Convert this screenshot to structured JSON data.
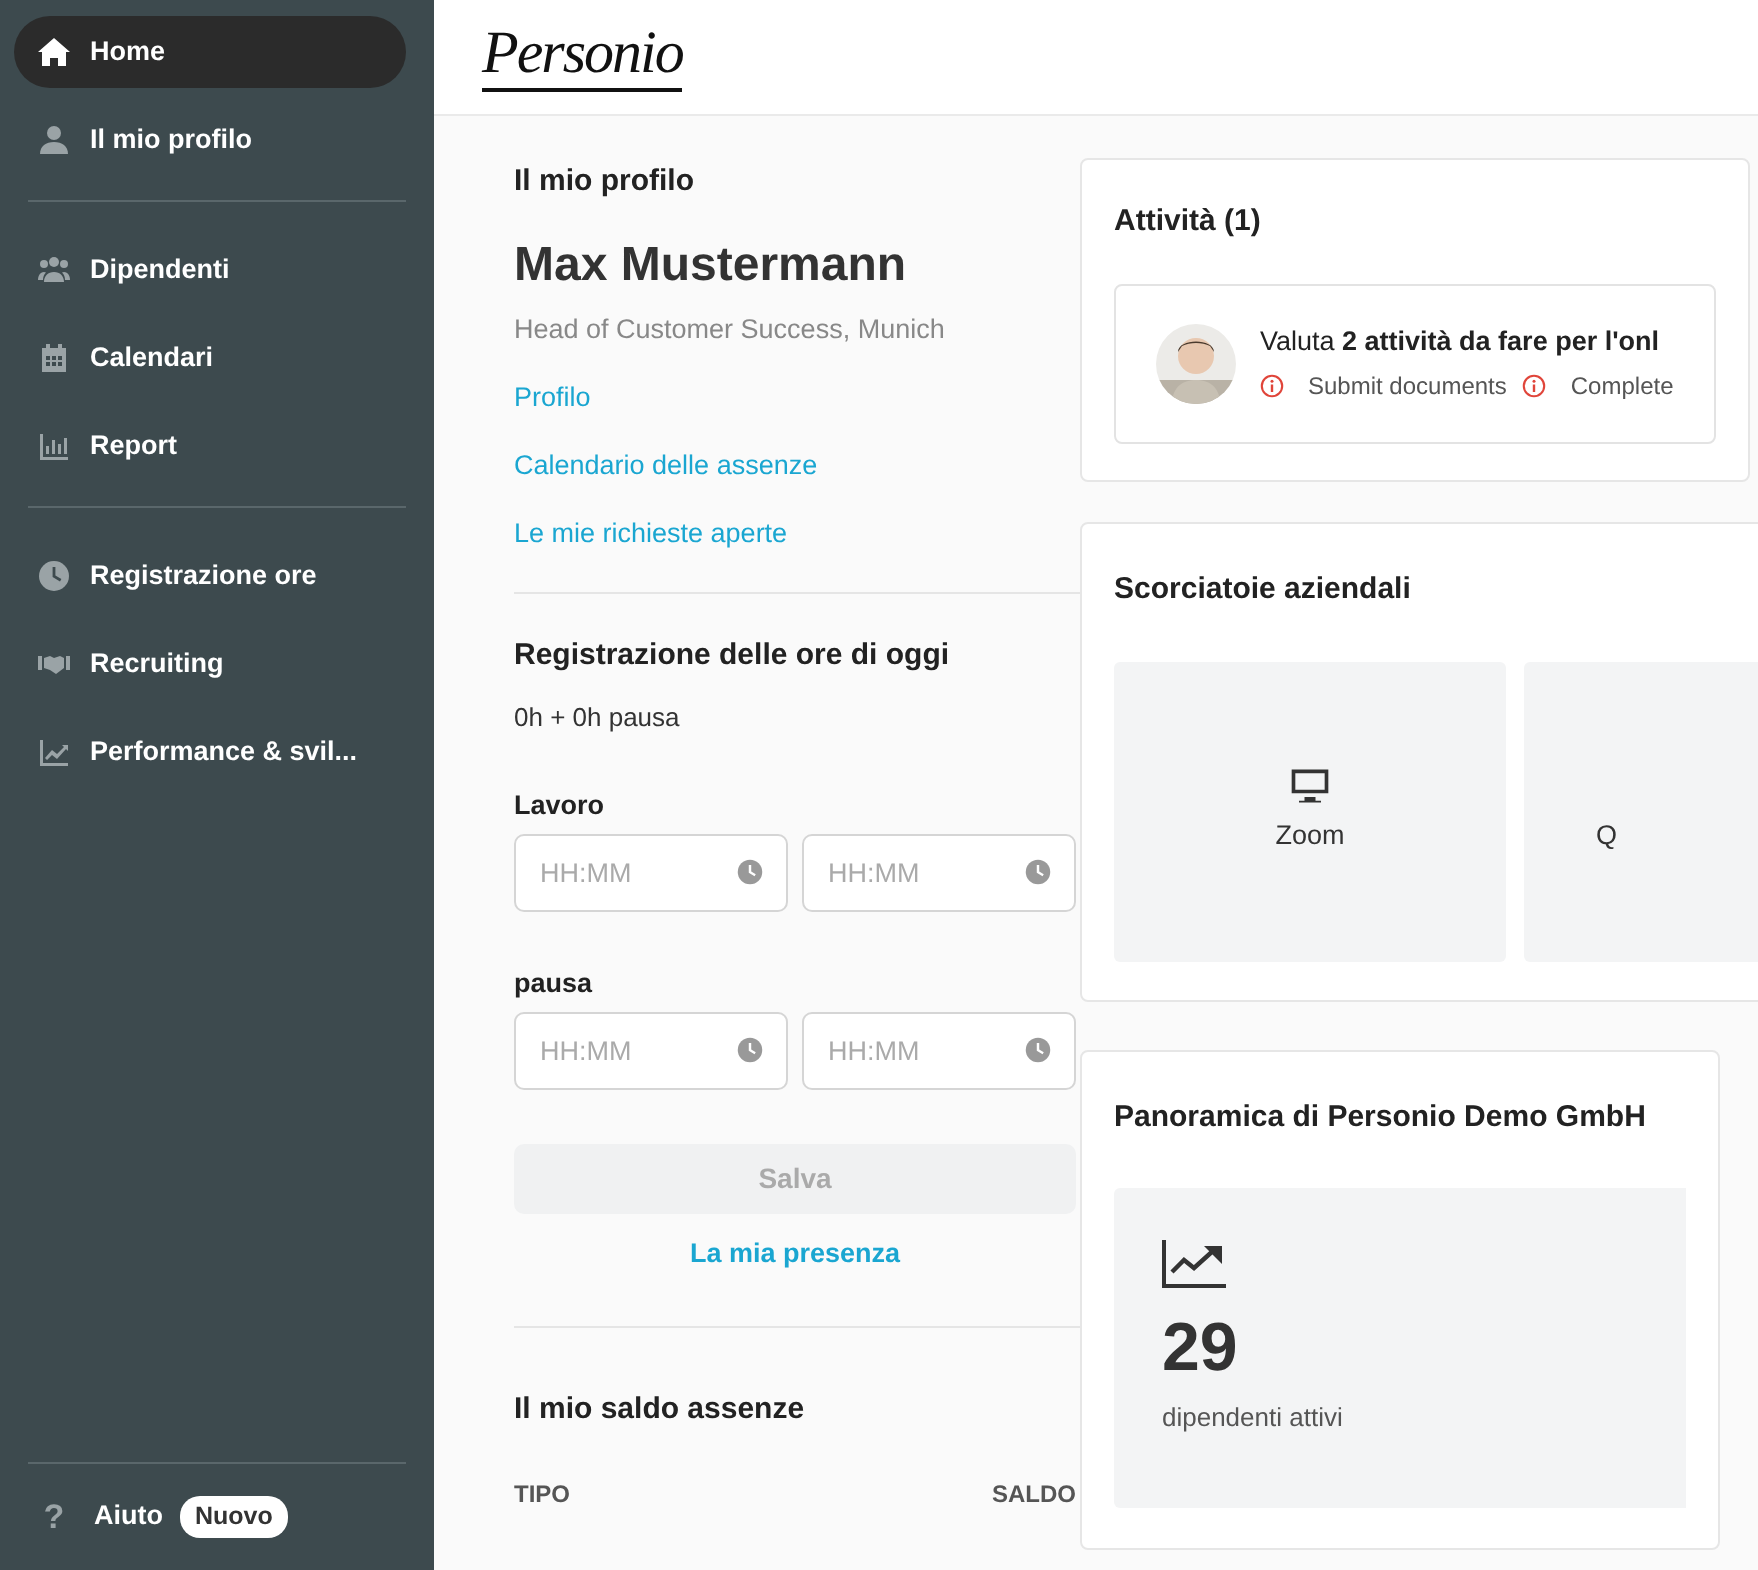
{
  "sidebar": {
    "groups": [
      [
        {
          "label": "Home",
          "selected": true
        },
        {
          "label": "Il mio profilo",
          "selected": false
        }
      ],
      [
        {
          "label": "Dipendenti",
          "selected": false
        },
        {
          "label": "Calendari",
          "selected": false
        },
        {
          "label": "Report",
          "selected": false
        }
      ],
      [
        {
          "label": "Registrazione ore",
          "selected": false
        },
        {
          "label": "Recruiting",
          "selected": false
        },
        {
          "label": "Performance & svil...",
          "selected": false
        }
      ]
    ],
    "help": {
      "icon": "?",
      "label": "Aiuto",
      "badge": "Nuovo"
    }
  },
  "logo": "Personio",
  "profile": {
    "section": "Il mio profilo",
    "name": "Max Mustermann",
    "subtitle": "Head of Customer Success, Munich",
    "links": [
      "Profilo",
      "Calendario delle assenze",
      "Le mie richieste aperte"
    ]
  },
  "time_tracking": {
    "title": "Registrazione delle ore di oggi",
    "summary": "0h + 0h pausa",
    "groups": [
      {
        "label": "Lavoro",
        "fields": [
          {
            "placeholder": "HH:MM"
          },
          {
            "placeholder": "HH:MM"
          }
        ]
      },
      {
        "label": "pausa",
        "fields": [
          {
            "placeholder": "HH:MM"
          },
          {
            "placeholder": "HH:MM"
          }
        ]
      }
    ],
    "save_button": {
      "label": "Salva",
      "disabled": true
    },
    "attendance_link": "La mia presenza"
  },
  "absence_balance": {
    "title": "Il mio saldo assenze",
    "columns": [
      "TIPO",
      "SALDO"
    ]
  },
  "tasks": {
    "title": "Attività (1)",
    "item": {
      "text": "Valuta **2 attività da fare per l'onl**",
      "subtasks": [
        "Submit documents",
        "Complete"
      ]
    }
  },
  "shortcuts": {
    "title": "Scorciatoie aziendali",
    "items": [
      {
        "label": "Zoom",
        "kind": "monitor"
      },
      {
        "label": "Q",
        "kind": "none"
      }
    ]
  },
  "overview": {
    "title": "Panoramica di Personio Demo GmbH",
    "stat": {
      "value": "29",
      "label": "dipendenti attivi"
    }
  }
}
